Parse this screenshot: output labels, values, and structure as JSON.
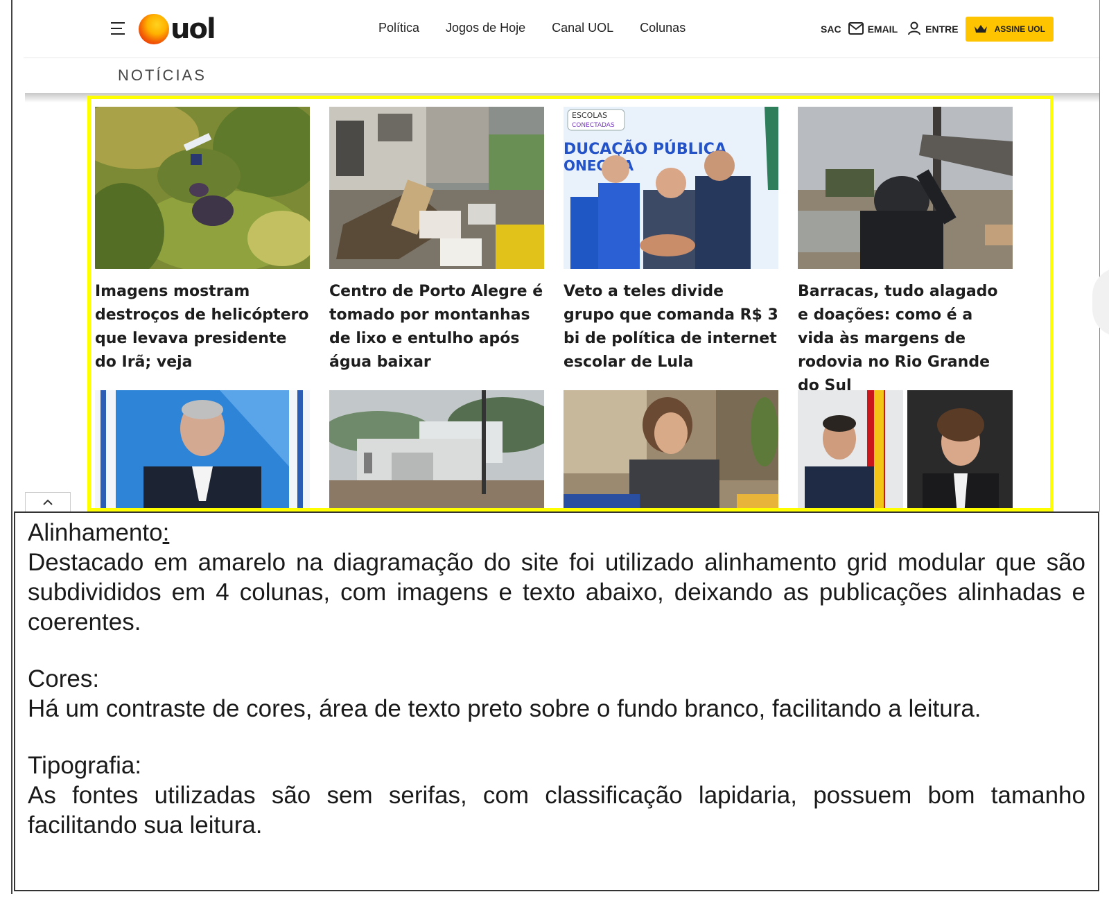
{
  "header": {
    "logo_text": "uol",
    "nav": [
      "Política",
      "Jogos de Hoje",
      "Canal UOL",
      "Colunas"
    ],
    "sac": "SAC",
    "email": "EMAIL",
    "entre": "ENTRE",
    "assine": "ASSINE UOL",
    "section": "NOTÍCIAS"
  },
  "brand_colors": {
    "highlight": "#ffff00",
    "assine_bg": "#ffc400"
  },
  "news": [
    {
      "headline": "Imagens mostram destroços de helicóptero que levava presidente do Irã; veja",
      "icon": "helicopter-wreck-photo"
    },
    {
      "headline": "Centro de Porto Alegre é tomado por montanhas de lixo e entulho após água baixar",
      "icon": "debris-street-photo"
    },
    {
      "headline": "Veto a teles divide grupo que comanda R$ 3 bi de política de internet escolar de Lula",
      "icon": "politicians-handshake-photo"
    },
    {
      "headline": "Barracas, tudo alagado e doações: como é a vida às margens de rodovia no Rio Grande do Sul",
      "icon": "flooded-road-photo"
    },
    {
      "headline": "",
      "icon": "netanyahu-photo"
    },
    {
      "headline": "",
      "icon": "flooded-building-photo"
    },
    {
      "headline": "",
      "icon": "smiling-woman-photo"
    },
    {
      "headline": "",
      "icon": "two-politicians-photo"
    }
  ],
  "photo_text": {
    "escolas": "ESCOLAS",
    "conectadas": "CONECTADAS",
    "banner": "DUCAÇÃO PÚBLICA",
    "banner2": "ONEC DA"
  },
  "notes": {
    "alinhamento_title": "Alinhamento",
    "alinhamento_colon": ":",
    "alinhamento_text": "Destacado em amarelo na diagramação do site foi utilizado alinhamento grid modular que são subdivididos em 4 colunas, com imagens e texto abaixo, deixando as publicações ali­nhadas e coerentes.",
    "cores_title": "Cores:",
    "cores_text": "Há um contraste de cores, área de texto preto sobre o fundo branco, facilitando a leitura.",
    "tipografia_title": "Tipografia:",
    "tipografia_text": "As fontes utilizadas são sem serifas, com classificação lapidaria, possuem bom tamanho facilitando sua leitura."
  }
}
